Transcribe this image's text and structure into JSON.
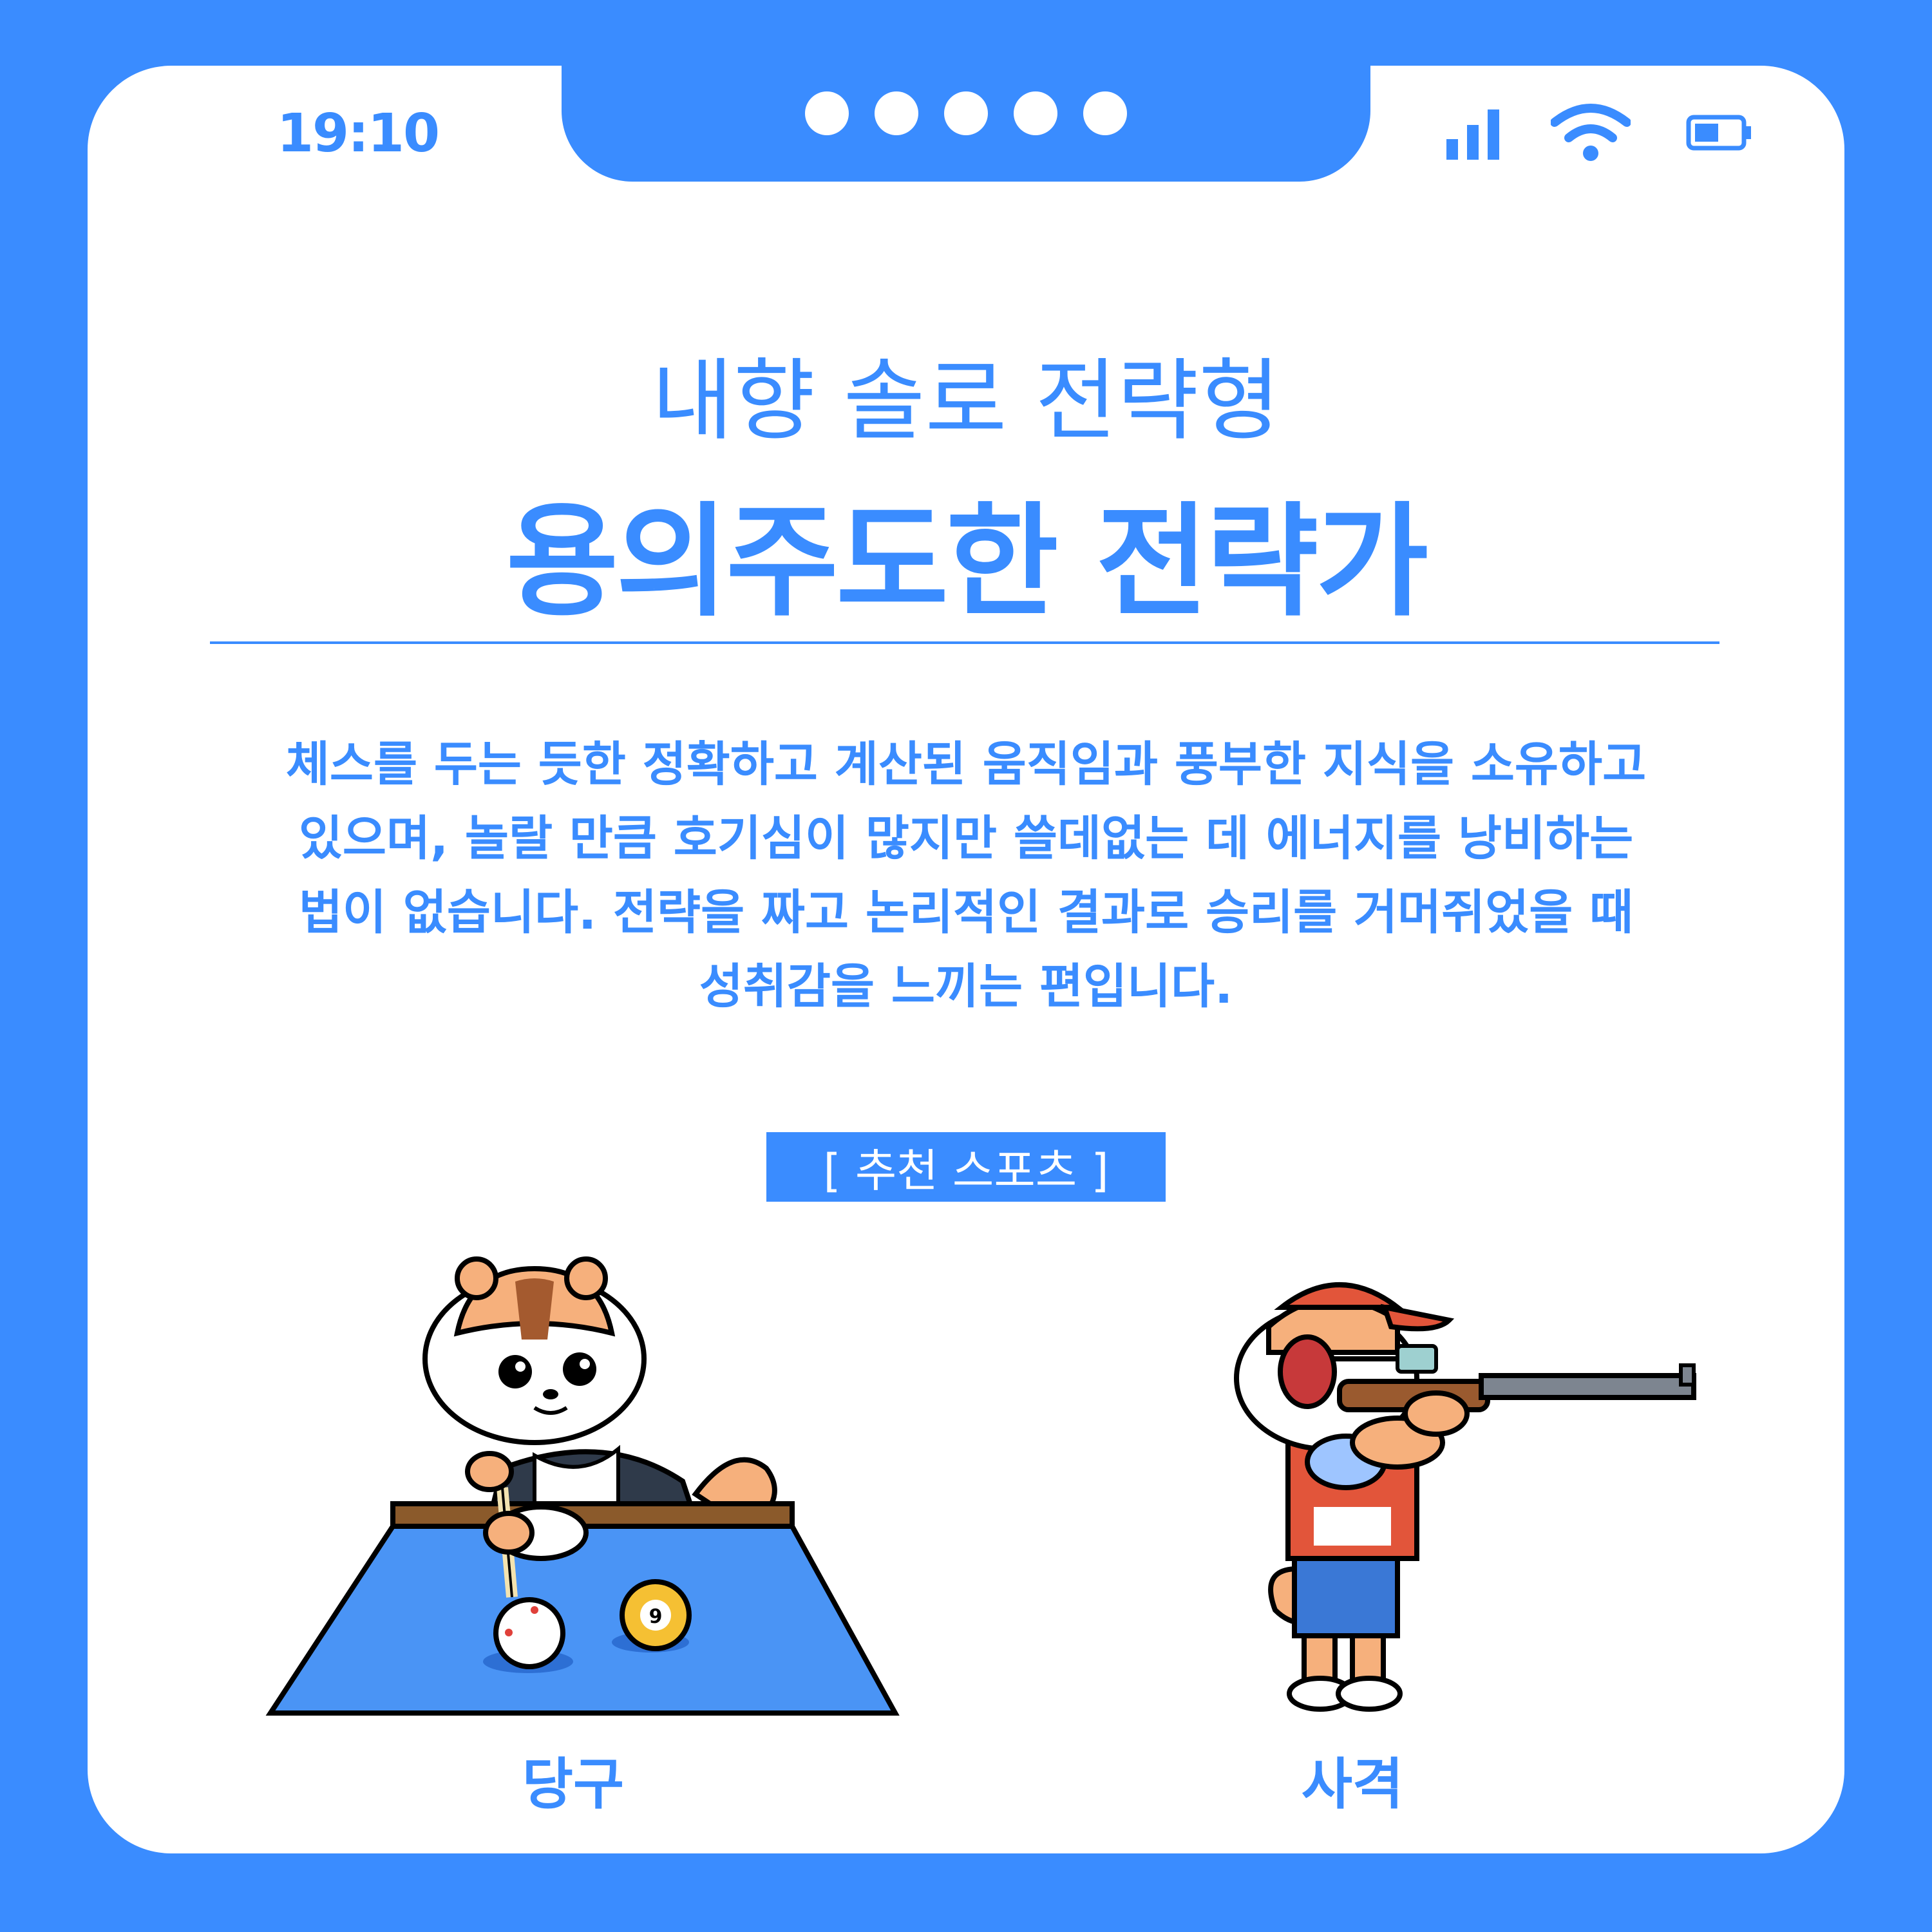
{
  "status_bar": {
    "time": "19:10",
    "icons": [
      "signal-icon",
      "wifi-icon",
      "battery-icon"
    ]
  },
  "heading": {
    "subtitle": "내향 솔로 전략형",
    "title": "용의주도한 전략가"
  },
  "description_lines": [
    "체스를 두는 듯한 정확하고 계산된 움직임과 풍부한 지식을 소유하고",
    "있으며, 놀랄 만큼 호기심이 많지만 쓸데없는 데 에너지를 낭비하는",
    "법이 없습니다. 전략을 짜고 논리적인 결과로 승리를 거머쥐었을 때",
    "성취감을 느끼는 편입니다."
  ],
  "recommend_label": "[ 추천 스포츠 ]",
  "sports": [
    {
      "label": "당구",
      "icon": "billiards-mascot-illustration"
    },
    {
      "label": "사격",
      "icon": "shooting-mascot-illustration"
    }
  ],
  "billiards_ball_number": "9",
  "colors": {
    "primary": "#3a8cff",
    "card": "#ffffff",
    "table": "#4a94f5",
    "fur": "#f6b07c"
  }
}
